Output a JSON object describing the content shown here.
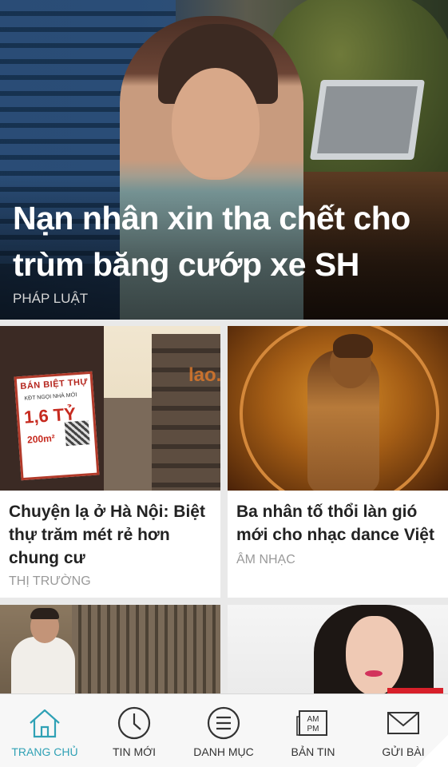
{
  "hero": {
    "title": "Nạn nhân xin tha chết cho trùm băng cướp xe SH",
    "category": "PHÁP LUẬT"
  },
  "cards": [
    {
      "title": "Chuyện lạ ở Hà Nội: Biệt thự trăm mét rẻ hơn chung cư",
      "category": "THỊ TRƯỜNG",
      "image_text": {
        "sign_header": "BÁN BIỆT THỰ",
        "sign_sub": "KĐT NGỌI NHÀ MỚI",
        "sign_price": "1,6 TỶ",
        "sign_area": "200m²",
        "watermark": "lao.vn"
      }
    },
    {
      "title": "Ba nhân tố thổi làn gió mới cho nhạc dance Việt",
      "category": "ÂM NHẠC"
    },
    {
      "title": "",
      "category": ""
    },
    {
      "title": "",
      "category": ""
    }
  ],
  "bottom_nav": {
    "active_color": "#2fa1b5",
    "items": [
      {
        "label": "TRANG CHỦ",
        "icon": "home-icon",
        "active": true
      },
      {
        "label": "TIN MỚI",
        "icon": "clock-icon",
        "active": false
      },
      {
        "label": "DANH MỤC",
        "icon": "menu-icon",
        "active": false
      },
      {
        "label": "BẢN TIN",
        "icon": "am-pm-icon",
        "active": false,
        "icon_text_top": "AM",
        "icon_text_bottom": "PM"
      },
      {
        "label": "GỬI BÀI",
        "icon": "envelope-icon",
        "active": false
      }
    ]
  }
}
